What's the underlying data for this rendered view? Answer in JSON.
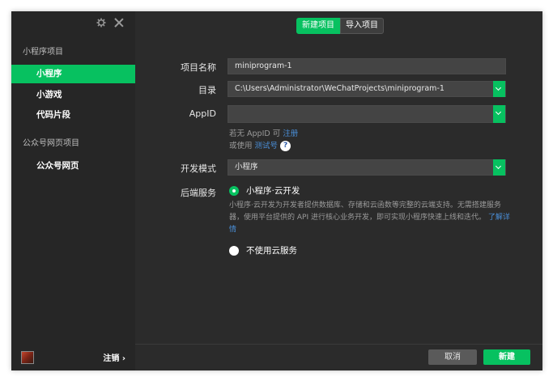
{
  "sidebar": {
    "sections": [
      {
        "title": "小程序项目",
        "items": [
          "小程序",
          "小游戏",
          "代码片段"
        ]
      },
      {
        "title": "公众号网页项目",
        "items": [
          "公众号网页"
        ]
      }
    ],
    "active_item": "小程序",
    "logout_label": "注销 ›",
    "icons": [
      "gear-icon",
      "close-icon"
    ]
  },
  "tabs": {
    "new_project": "新建项目",
    "import_project": "导入项目",
    "active": "新建项目"
  },
  "form": {
    "project_name_label": "项目名称",
    "project_name_value": "miniprogram-1",
    "directory_label": "目录",
    "directory_value": "C:\\Users\\Administrator\\WeChatProjects\\miniprogram-1",
    "appid_label": "AppID",
    "appid_value": "",
    "appid_hint_prefix": "若无 AppID 可",
    "appid_hint_register": "注册",
    "appid_hint_or": "或使用",
    "appid_hint_test": "测试号",
    "appid_help": "?",
    "dev_mode_label": "开发模式",
    "dev_mode_value": "小程序",
    "backend_label": "后端服务",
    "backend_option_cloud": "小程序·云开发",
    "backend_cloud_desc": "小程序·云开发为开发者提供数据库、存储和云函数等完整的云端支持。无需搭建服务器，使用平台提供的 API 进行核心业务开发，即可实现小程序快速上线和迭代。",
    "backend_learn_more": "了解详情",
    "backend_option_none": "不使用云服务",
    "backend_selected": "小程序·云开发"
  },
  "buttons": {
    "cancel": "取消",
    "create": "新建"
  },
  "colors": {
    "accent": "#07c160",
    "panel": "#2b2b2b",
    "sidebar": "#262626",
    "link": "#4a8fd8"
  }
}
